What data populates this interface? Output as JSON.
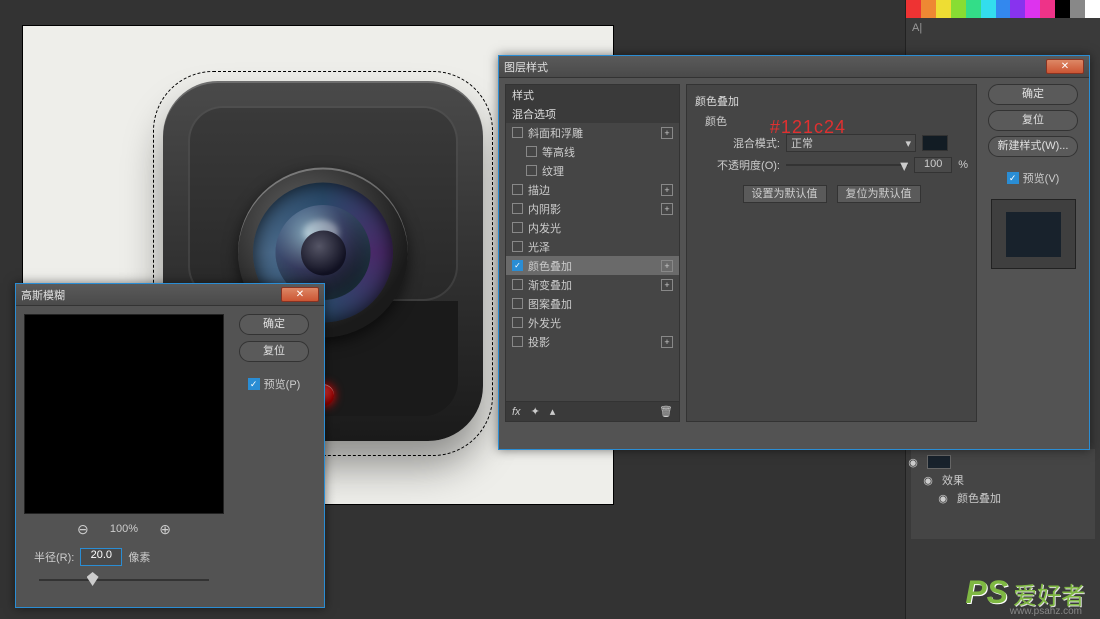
{
  "blur_dialog": {
    "title": "高斯模糊",
    "ok": "确定",
    "reset": "复位",
    "preview": "预览(P)",
    "zoom": "100%",
    "radius_label": "半径(R):",
    "radius_value": "20.0",
    "radius_unit": "像素"
  },
  "layer_style": {
    "title": "图层样式",
    "styles_header": "样式",
    "blend_header": "混合选项",
    "items": [
      {
        "label": "斜面和浮雕",
        "checked": false,
        "expandable": true
      },
      {
        "label": "等高线",
        "checked": false,
        "indent": true
      },
      {
        "label": "纹理",
        "checked": false,
        "indent": true
      },
      {
        "label": "描边",
        "checked": false,
        "expandable": true
      },
      {
        "label": "内阴影",
        "checked": false,
        "expandable": true
      },
      {
        "label": "内发光",
        "checked": false
      },
      {
        "label": "光泽",
        "checked": false
      },
      {
        "label": "颜色叠加",
        "checked": true,
        "active": true,
        "expandable": true
      },
      {
        "label": "渐变叠加",
        "checked": false,
        "expandable": true
      },
      {
        "label": "图案叠加",
        "checked": false
      },
      {
        "label": "外发光",
        "checked": false
      },
      {
        "label": "投影",
        "checked": false,
        "expandable": true
      }
    ],
    "panel_title": "颜色叠加",
    "panel_subtitle": "颜色",
    "blend_mode_label": "混合模式:",
    "blend_mode_value": "正常",
    "opacity_label": "不透明度(O):",
    "opacity_value": "100",
    "opacity_unit": "%",
    "set_default": "设置为默认值",
    "reset_default": "复位为默认值",
    "hex_note": "#121c24",
    "ok": "确定",
    "reset": "复位",
    "new_style": "新建样式(W)...",
    "preview": "预览(V)",
    "fx": "fx"
  },
  "layers": {
    "effects": "效果",
    "color_overlay": "颜色叠加"
  },
  "swatch_colors": [
    "#e33",
    "#e83",
    "#ed3",
    "#8d3",
    "#3d8",
    "#3de",
    "#38e",
    "#83e",
    "#d3e",
    "#e38",
    "#000",
    "#888",
    "#fff"
  ],
  "watermark": {
    "ps": "PS",
    "text": "爱好者",
    "url": "www.psahz.com"
  }
}
